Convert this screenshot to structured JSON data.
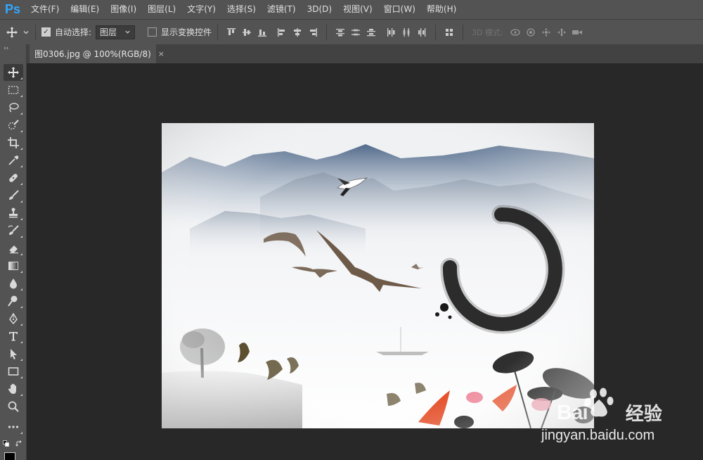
{
  "app": {
    "logo": "Ps",
    "menu": [
      "文件(F)",
      "编辑(E)",
      "图像(I)",
      "图层(L)",
      "文字(Y)",
      "选择(S)",
      "滤镜(T)",
      "3D(D)",
      "视图(V)",
      "窗口(W)",
      "帮助(H)"
    ]
  },
  "options": {
    "auto_select_label": "自动选择:",
    "auto_select_value": "图层",
    "show_transform_label": "显示变换控件",
    "mode_label": "3D 模式:"
  },
  "document": {
    "tab_title": "图0306.jpg @ 100%(RGB/8)",
    "close_glyph": "×"
  },
  "watermark": {
    "brand": "Bai",
    "brand_suffix": "经验",
    "url": "jingyan.baidu.com"
  },
  "colors": {
    "accent": "#31a8ff",
    "chrome": "#535353",
    "canvas_bg": "#282828"
  }
}
